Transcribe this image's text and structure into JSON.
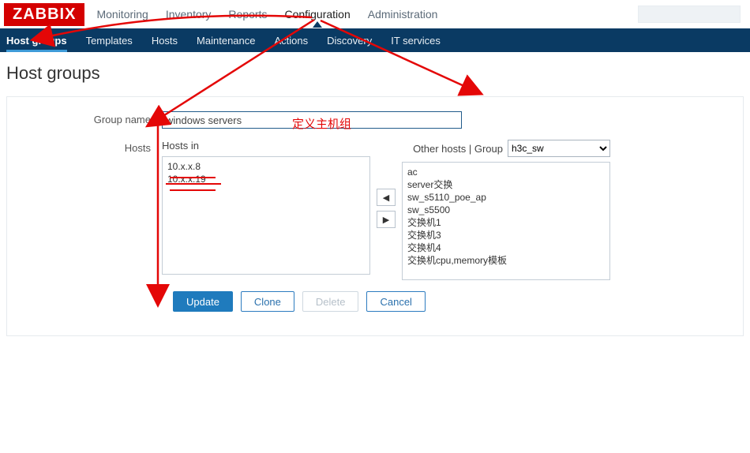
{
  "logo": "ZABBIX",
  "topnav": {
    "items": [
      "Monitoring",
      "Inventory",
      "Reports",
      "Configuration",
      "Administration"
    ],
    "active": "Configuration"
  },
  "subnav": {
    "items": [
      "Host groups",
      "Templates",
      "Hosts",
      "Maintenance",
      "Actions",
      "Discovery",
      "IT services"
    ],
    "active": "Host groups"
  },
  "page_title": "Host groups",
  "form": {
    "group_name_label": "Group name",
    "group_name_value": "windows servers",
    "hosts_label": "Hosts",
    "hosts_in_label": "Hosts in",
    "other_hosts_label": "Other hosts | Group",
    "group_select_value": "h3c_sw",
    "hosts_in_list": [
      "10.x.x.8",
      "10.x.x.19"
    ],
    "other_hosts_list": [
      "ac",
      "server交换",
      "sw_s5110_poe_ap",
      "sw_s5500",
      "交换机1",
      "交换机3",
      "交换机4",
      "交换机cpu,memory模板"
    ]
  },
  "buttons": {
    "update": "Update",
    "clone": "Clone",
    "delete": "Delete",
    "cancel": "Cancel"
  },
  "annotation": "定义主机组",
  "icons": {
    "move_left": "◀",
    "move_right": "▶"
  }
}
